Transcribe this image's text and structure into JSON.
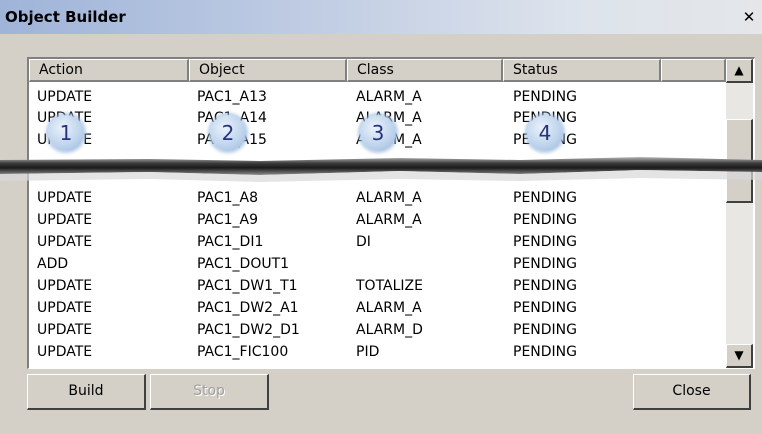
{
  "window": {
    "title": "Object Builder",
    "close_glyph": "✕"
  },
  "table": {
    "columns": [
      "Action",
      "Object",
      "Class",
      "Status"
    ],
    "rows": [
      {
        "action": "UPDATE",
        "object": "PAC1_A13",
        "class": "ALARM_A",
        "status": "PENDING"
      },
      {
        "action": "UPDATE",
        "object": "PAC1_A14",
        "class": "ALARM_A",
        "status": "PENDING"
      },
      {
        "action": "UPDATE",
        "object": "PAC1_A15",
        "class": "ALARM_A",
        "status": "PENDING"
      },
      {
        "action": "UPDATE",
        "object": "PAC1_A8",
        "class": "ALARM_A",
        "status": "PENDING"
      },
      {
        "action": "UPDATE",
        "object": "PAC1_A9",
        "class": "ALARM_A",
        "status": "PENDING"
      },
      {
        "action": "UPDATE",
        "object": "PAC1_DI1",
        "class": "DI",
        "status": "PENDING"
      },
      {
        "action": "ADD",
        "object": "PAC1_DOUT1",
        "class": "",
        "status": "PENDING"
      },
      {
        "action": "UPDATE",
        "object": "PAC1_DW1_T1",
        "class": "TOTALIZE",
        "status": "PENDING"
      },
      {
        "action": "UPDATE",
        "object": "PAC1_DW2_A1",
        "class": "ALARM_A",
        "status": "PENDING"
      },
      {
        "action": "UPDATE",
        "object": "PAC1_DW2_D1",
        "class": "ALARM_D",
        "status": "PENDING"
      },
      {
        "action": "UPDATE",
        "object": "PAC1_FIC100",
        "class": "PID",
        "status": "PENDING"
      }
    ]
  },
  "callouts": [
    "1",
    "2",
    "3",
    "4"
  ],
  "buttons": {
    "build": "Build",
    "stop": "Stop",
    "close": "Close"
  },
  "scrollbar": {
    "up_glyph": "▲",
    "down_glyph": "▼"
  },
  "colors": {
    "callout_text": "#27327a",
    "title_gradient_start": "#9fb4d9",
    "disabled_text": "#a0a0a0"
  }
}
